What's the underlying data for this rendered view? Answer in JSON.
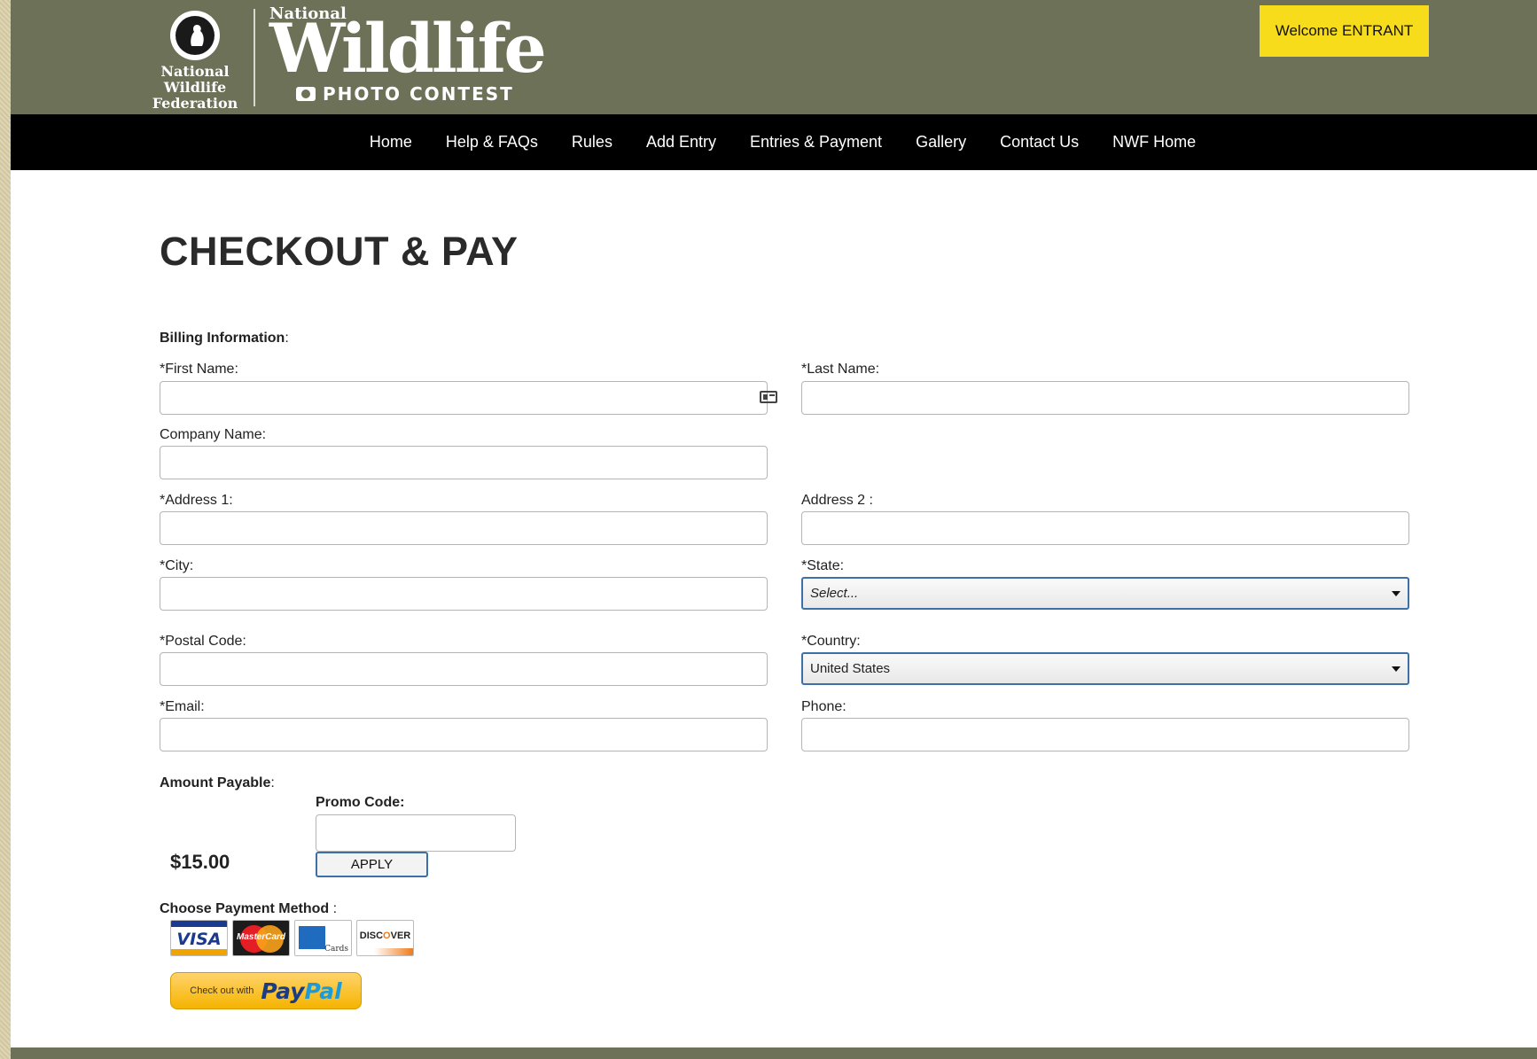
{
  "header": {
    "org_name": "National\nWildlife\nFederation",
    "contest_national": "National",
    "contest_wildlife": "Wildlife",
    "contest_photo": "PHOTO CONTEST",
    "welcome": "Welcome ENTRANT"
  },
  "nav": {
    "items": [
      "Home",
      "Help & FAQs",
      "Rules",
      "Add Entry",
      "Entries & Payment",
      "Gallery",
      "Contact Us",
      "NWF Home"
    ]
  },
  "page": {
    "title": "CHECKOUT & PAY"
  },
  "billing": {
    "section_label": "Billing Information",
    "section_suffix": ":",
    "first_name_label": "*First Name:",
    "first_name_value": "",
    "last_name_label": "*Last Name:",
    "last_name_value": "",
    "company_label": "Company Name:",
    "company_value": "",
    "address1_label": "*Address 1:",
    "address1_value": "",
    "address2_label": "Address 2 :",
    "address2_value": "",
    "city_label": "*City:",
    "city_value": "",
    "state_label": "*State:",
    "state_value": "Select...",
    "postal_label": "*Postal Code:",
    "postal_value": "",
    "country_label": "*Country:",
    "country_value": "United States",
    "email_label": "*Email:",
    "email_value": "",
    "phone_label": "Phone:",
    "phone_value": ""
  },
  "payment": {
    "amount_label": "Amount Payable",
    "amount_suffix": ":",
    "amount": "$15.00",
    "promo_label": "Promo Code:",
    "promo_value": "",
    "apply_label": "APPLY",
    "method_label": "Choose Payment Method",
    "method_suffix": " :",
    "cards": {
      "visa": "VISA",
      "mastercard": "MasterCard",
      "amex": "Cards",
      "discover_a": "DISC",
      "discover_o": "O",
      "discover_b": "VER"
    },
    "paypal_small": "Check out with",
    "paypal_a": "Pay",
    "paypal_b": "Pal"
  },
  "colors": {
    "header_bg": "#6d7158",
    "nav_bg": "#000000",
    "welcome_bg": "#f7dc1c",
    "select_border": "#3d6fa8"
  },
  "icons": {
    "contact_card": "contact-card-icon",
    "camera": "camera-icon",
    "caret": "chevron-down-icon"
  }
}
